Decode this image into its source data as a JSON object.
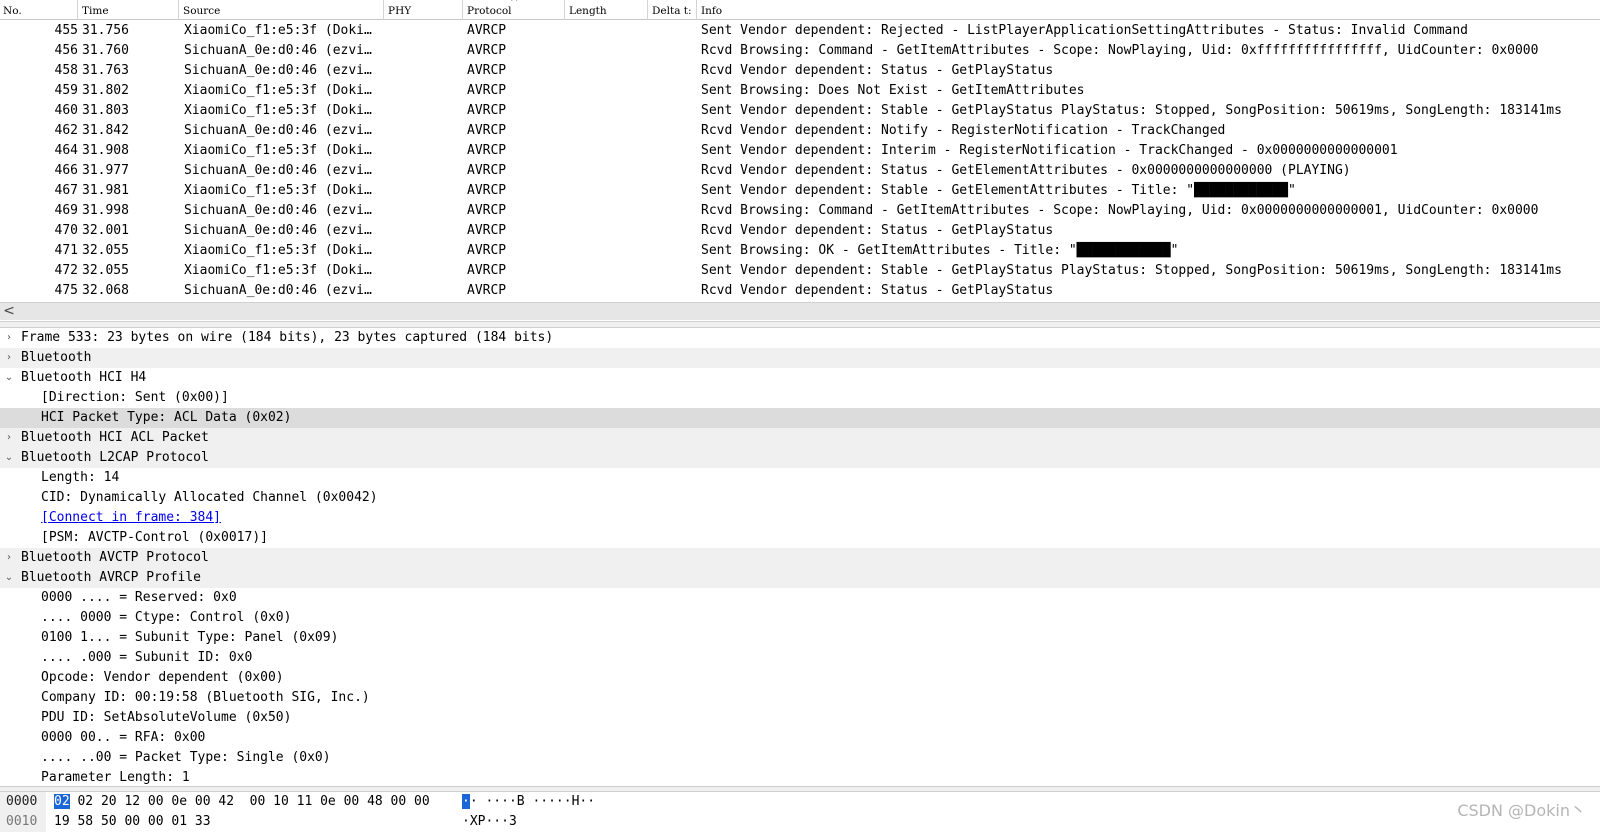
{
  "packet_list": {
    "headers": [
      "No.",
      "Time",
      "Source",
      "PHY",
      "Protocol",
      "Length",
      "Delta t:",
      "Info"
    ],
    "rows": [
      {
        "no": "455",
        "time": "31.756",
        "source": "XiaomiCo_f1:e5:3f (Doki…",
        "protocol": "AVRCP",
        "info": "Sent Vendor dependent: Rejected - ListPlayerApplicationSettingAttributes - Status: Invalid Command"
      },
      {
        "no": "456",
        "time": "31.760",
        "source": "SichuanA_0e:d0:46 (ezvi…",
        "protocol": "AVRCP",
        "info": "Rcvd Browsing: Command - GetItemAttributes - Scope: NowPlaying, Uid: 0xffffffffffffffff, UidCounter: 0x0000"
      },
      {
        "no": "458",
        "time": "31.763",
        "source": "SichuanA_0e:d0:46 (ezvi…",
        "protocol": "AVRCP",
        "info": "Rcvd Vendor dependent: Status - GetPlayStatus"
      },
      {
        "no": "459",
        "time": "31.802",
        "source": "XiaomiCo_f1:e5:3f (Doki…",
        "protocol": "AVRCP",
        "info": "Sent Browsing: Does Not Exist - GetItemAttributes"
      },
      {
        "no": "460",
        "time": "31.803",
        "source": "XiaomiCo_f1:e5:3f (Doki…",
        "protocol": "AVRCP",
        "info": "Sent Vendor dependent: Stable - GetPlayStatus PlayStatus: Stopped, SongPosition: 50619ms, SongLength: 183141ms"
      },
      {
        "no": "462",
        "time": "31.842",
        "source": "SichuanA_0e:d0:46 (ezvi…",
        "protocol": "AVRCP",
        "info": "Rcvd Vendor dependent: Notify - RegisterNotification - TrackChanged"
      },
      {
        "no": "464",
        "time": "31.908",
        "source": "XiaomiCo_f1:e5:3f (Doki…",
        "protocol": "AVRCP",
        "info": "Sent Vendor dependent: Interim - RegisterNotification - TrackChanged - 0x0000000000000001"
      },
      {
        "no": "466",
        "time": "31.977",
        "source": "SichuanA_0e:d0:46 (ezvi…",
        "protocol": "AVRCP",
        "info": "Rcvd Vendor dependent: Status - GetElementAttributes - 0x0000000000000000 (PLAYING)"
      },
      {
        "no": "467",
        "time": "31.981",
        "source": "XiaomiCo_f1:e5:3f (Doki…",
        "protocol": "AVRCP",
        "info": "Sent Vendor dependent: Stable - GetElementAttributes - Title: \"████████████\""
      },
      {
        "no": "469",
        "time": "31.998",
        "source": "SichuanA_0e:d0:46 (ezvi…",
        "protocol": "AVRCP",
        "info": "Rcvd Browsing: Command - GetItemAttributes - Scope: NowPlaying, Uid: 0x0000000000000001, UidCounter: 0x0000"
      },
      {
        "no": "470",
        "time": "32.001",
        "source": "SichuanA_0e:d0:46 (ezvi…",
        "protocol": "AVRCP",
        "info": "Rcvd Vendor dependent: Status - GetPlayStatus"
      },
      {
        "no": "471",
        "time": "32.055",
        "source": "XiaomiCo_f1:e5:3f (Doki…",
        "protocol": "AVRCP",
        "info": "Sent Browsing: OK - GetItemAttributes - Title: \"████████████\""
      },
      {
        "no": "472",
        "time": "32.055",
        "source": "XiaomiCo_f1:e5:3f (Doki…",
        "protocol": "AVRCP",
        "info": "Sent Vendor dependent: Stable - GetPlayStatus PlayStatus: Stopped, SongPosition: 50619ms, SongLength: 183141ms"
      },
      {
        "no": "475",
        "time": "32.068",
        "source": "SichuanA_0e:d0:46 (ezvi…",
        "protocol": "AVRCP",
        "info": "Rcvd Vendor dependent: Status - GetPlayStatus"
      }
    ]
  },
  "scroll": {
    "left_arrow": "<"
  },
  "details": [
    {
      "text": "Frame 533: 23 bytes on wire (184 bits), 23 bytes captured (184 bits)",
      "level": 0,
      "toggle": "›",
      "shade": false
    },
    {
      "text": "Bluetooth",
      "level": 0,
      "toggle": "›",
      "shade": true
    },
    {
      "text": "Bluetooth HCI H4",
      "level": 0,
      "toggle": "⌄",
      "shade": false
    },
    {
      "text": "[Direction: Sent (0x00)]",
      "level": 1,
      "toggle": "",
      "shade": false
    },
    {
      "text": "HCI Packet Type: ACL Data (0x02)",
      "level": 1,
      "toggle": "",
      "shade": false,
      "selected": true
    },
    {
      "text": "Bluetooth HCI ACL Packet",
      "level": 0,
      "toggle": "›",
      "shade": true
    },
    {
      "text": "Bluetooth L2CAP Protocol",
      "level": 0,
      "toggle": "⌄",
      "shade": true
    },
    {
      "text": "Length: 14",
      "level": 1,
      "toggle": "",
      "shade": false
    },
    {
      "text": "CID: Dynamically Allocated Channel (0x0042)",
      "level": 1,
      "toggle": "",
      "shade": false
    },
    {
      "text": "[Connect in frame: 384]",
      "level": 1,
      "toggle": "",
      "shade": false,
      "link": true
    },
    {
      "text": "[PSM: AVCTP-Control (0x0017)]",
      "level": 1,
      "toggle": "",
      "shade": false
    },
    {
      "text": "Bluetooth AVCTP Protocol",
      "level": 0,
      "toggle": "›",
      "shade": true
    },
    {
      "text": "Bluetooth AVRCP Profile",
      "level": 0,
      "toggle": "⌄",
      "shade": true
    },
    {
      "text": "0000 .... = Reserved: 0x0",
      "level": 1,
      "toggle": "",
      "shade": false
    },
    {
      "text": ".... 0000 = Ctype: Control (0x0)",
      "level": 1,
      "toggle": "",
      "shade": false
    },
    {
      "text": "0100 1... = Subunit Type: Panel (0x09)",
      "level": 1,
      "toggle": "",
      "shade": false
    },
    {
      "text": ".... .000 = Subunit ID: 0x0",
      "level": 1,
      "toggle": "",
      "shade": false
    },
    {
      "text": "Opcode: Vendor dependent (0x00)",
      "level": 1,
      "toggle": "",
      "shade": false
    },
    {
      "text": "Company ID: 00:19:58 (Bluetooth SIG, Inc.)",
      "level": 1,
      "toggle": "",
      "shade": false
    },
    {
      "text": "PDU ID: SetAbsoluteVolume (0x50)",
      "level": 1,
      "toggle": "",
      "shade": false
    },
    {
      "text": "0000 00.. = RFA: 0x00",
      "level": 1,
      "toggle": "",
      "shade": false
    },
    {
      "text": ".... ..00 = Packet Type: Single (0x0)",
      "level": 1,
      "toggle": "",
      "shade": false
    },
    {
      "text": "Parameter Length: 1",
      "level": 1,
      "toggle": "",
      "shade": false
    }
  ],
  "bytes": [
    {
      "offset": "0000",
      "hex_sel": "02",
      "hex_rest": " 02 20 12 00 0e 00 42  00 10 11 0e 00 48 00 00",
      "ascii_sel": "·",
      "ascii_rest": "· ····B ·····H··"
    },
    {
      "offset": "0010",
      "hex_sel": "",
      "hex_rest": "19 58 50 00 00 01 33",
      "ascii_sel": "",
      "ascii_rest": "·XP···3"
    }
  ],
  "watermark": "CSDN @Dokin丶",
  "colors": {
    "selection": "#1a66d6",
    "shade": "#f0f0f0",
    "link": "#0000ee"
  }
}
